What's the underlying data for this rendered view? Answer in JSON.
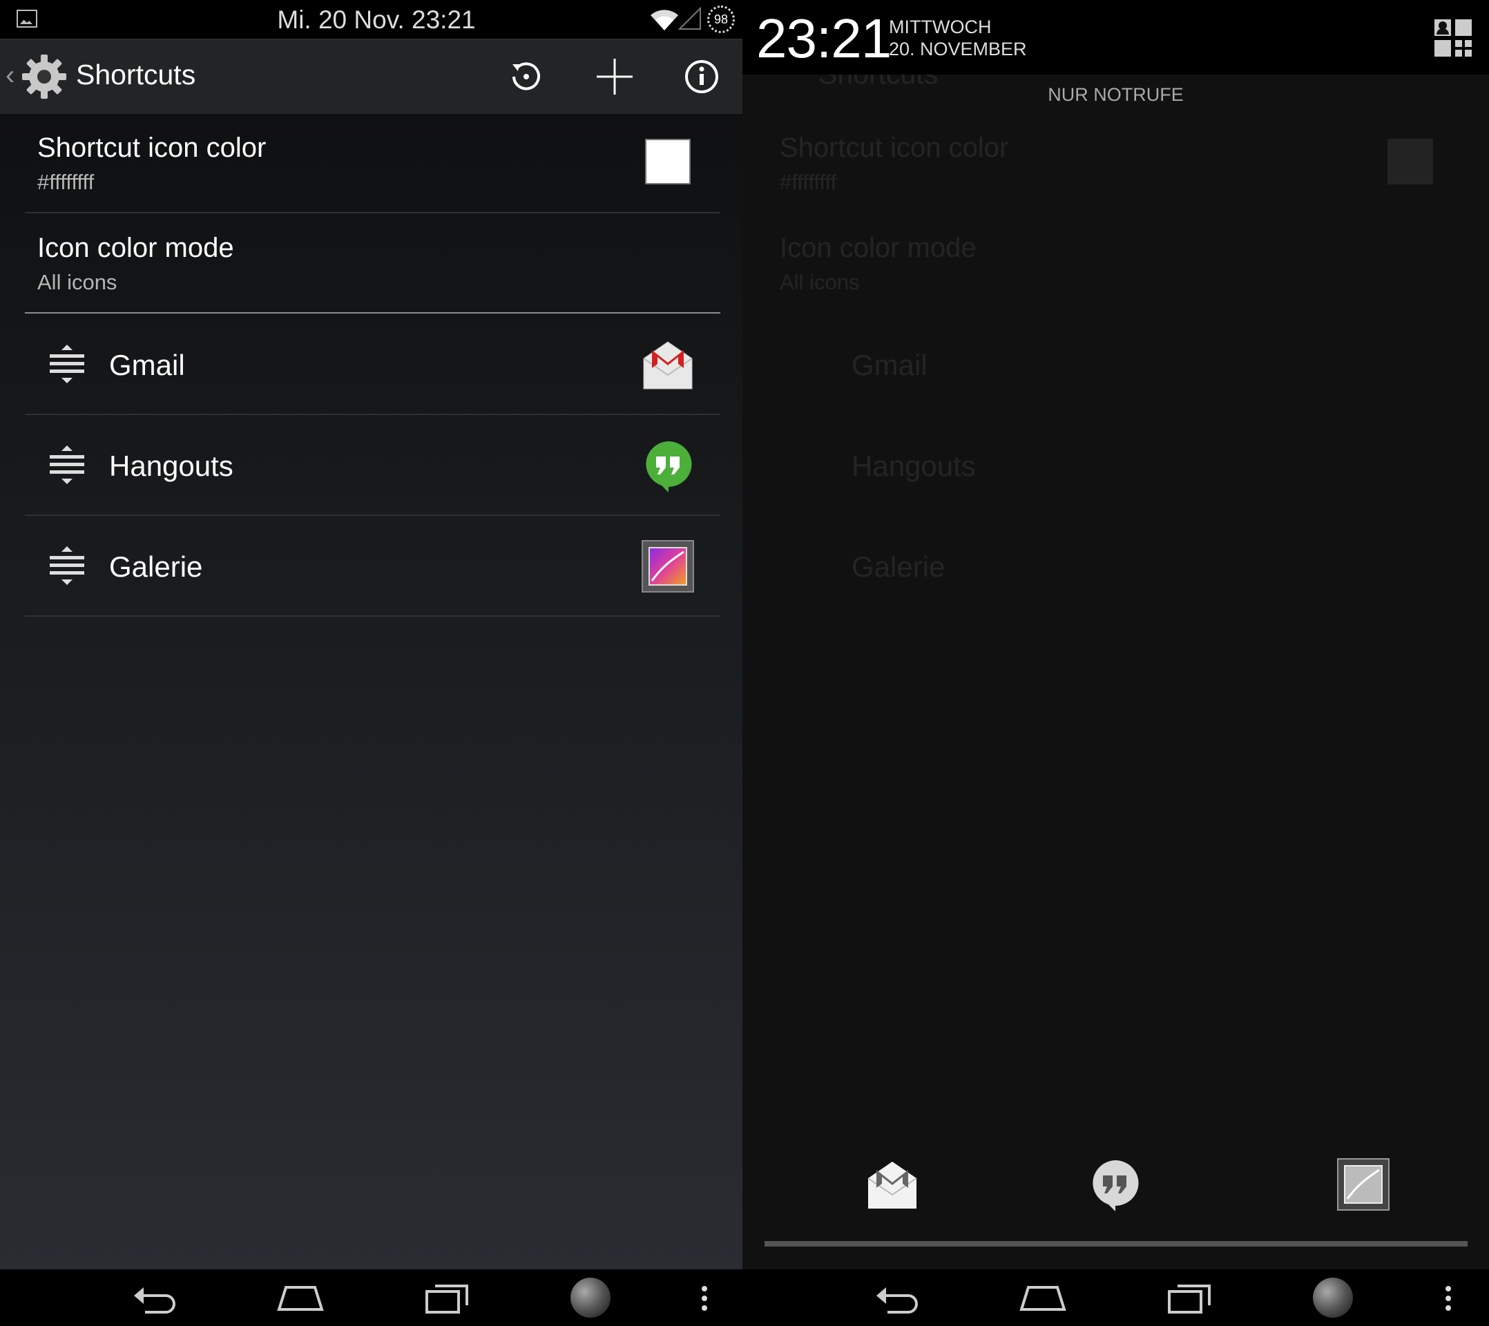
{
  "status_bar": {
    "datetime": "Mi. 20 Nov. 23:21",
    "battery": "98"
  },
  "action_bar": {
    "title": "Shortcuts",
    "icons": [
      "gear-icon",
      "restore-icon",
      "add-icon",
      "info-icon"
    ]
  },
  "preferences": [
    {
      "title": "Shortcut icon color",
      "summary": "#ffffffff",
      "swatch_color": "#ffffff"
    },
    {
      "title": "Icon color mode",
      "summary": "All icons"
    }
  ],
  "shortcuts": [
    {
      "label": "Gmail",
      "icon": "gmail-icon"
    },
    {
      "label": "Hangouts",
      "icon": "hangouts-icon"
    },
    {
      "label": "Galerie",
      "icon": "gallery-icon"
    }
  ],
  "lockscreen": {
    "time": "23:21",
    "weekday": "MITTWOCH",
    "date": "20. NOVEMBER",
    "emergency": "NUR NOTRUFE"
  },
  "colors": {
    "hangouts_green": "#4caf3a",
    "gmail_red": "#d32020"
  }
}
